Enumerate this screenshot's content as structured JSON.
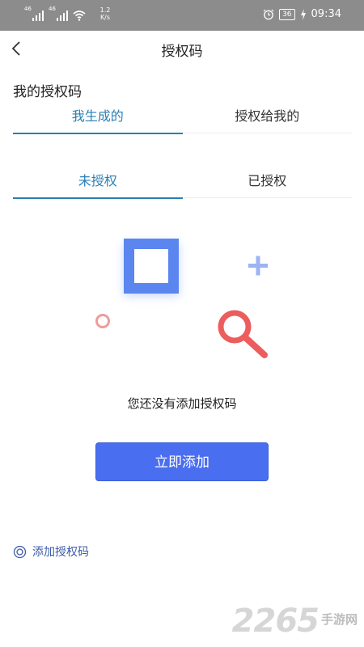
{
  "status_bar": {
    "signal_1_label": "46",
    "signal_2_label": "46",
    "speed_value": "1.2",
    "speed_unit": "K/s",
    "battery": "36",
    "time": "09:34"
  },
  "header": {
    "title": "授权码"
  },
  "section": {
    "title": "我的授权码"
  },
  "primary_tabs": [
    {
      "label": "我生成的",
      "active": true
    },
    {
      "label": "授权给我的",
      "active": false
    }
  ],
  "secondary_tabs": [
    {
      "label": "未授权",
      "active": true
    },
    {
      "label": "已授权",
      "active": false
    }
  ],
  "empty_state": {
    "message": "您还没有添加授权码"
  },
  "actions": {
    "add_now_label": "立即添加",
    "add_code_link": "添加授权码"
  },
  "watermark": {
    "number": "2265",
    "text": "手游网"
  },
  "colors": {
    "accent": "#2a7fb4",
    "button": "#4a6ef0",
    "link": "#3b5aa8",
    "square": "#5b86f0",
    "magnifier": "#ec5d5d",
    "status_bar": "#8c8c8c"
  }
}
